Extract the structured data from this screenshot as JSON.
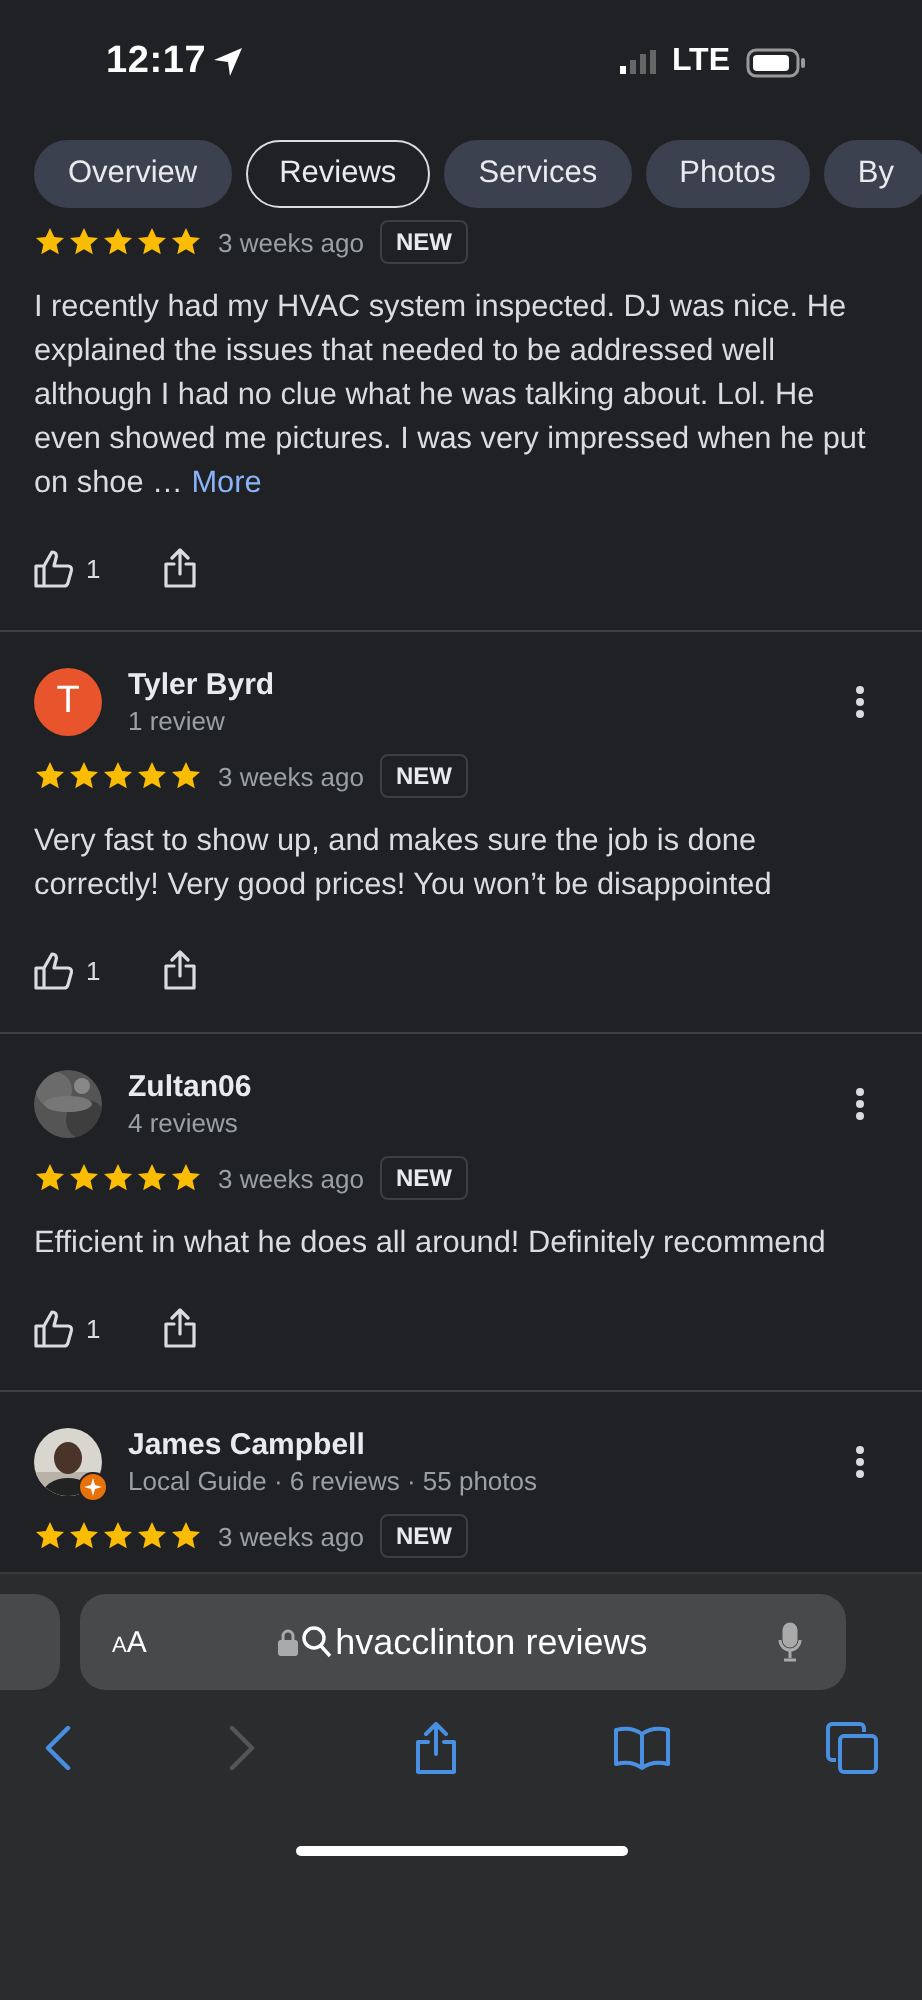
{
  "status_bar": {
    "time": "12:17",
    "network": "LTE"
  },
  "tabs": [
    {
      "label": "Overview",
      "selected": false
    },
    {
      "label": "Reviews",
      "selected": true
    },
    {
      "label": "Services",
      "selected": false
    },
    {
      "label": "Photos",
      "selected": false
    },
    {
      "label": "By",
      "selected": false
    }
  ],
  "reviews": [
    {
      "kind": "partial",
      "stars": 5,
      "time": "3 weeks ago",
      "badge": "NEW",
      "text": "I recently had my HVAC system inspected. DJ was nice. He explained the issues that needed to be addressed well although I had no clue what he was talking about. Lol. He even showed me pictures. I was very impressed when he put on shoe …",
      "more": "More",
      "likes": "1"
    },
    {
      "kind": "letter",
      "name": "Tyler Byrd",
      "initial": "T",
      "color": "#e8542c",
      "meta": "1 review",
      "stars": 5,
      "time": "3 weeks ago",
      "badge": "NEW",
      "text": "Very fast to show up, and makes sure the job is done correctly! Very good prices! You won’t be disappointed",
      "likes": "1"
    },
    {
      "name": "Zultan06",
      "meta": "4 reviews",
      "stars": 5,
      "time": "3 weeks ago",
      "badge": "NEW",
      "text": "Efficient in what he does all around! Definitely recommend",
      "likes": "1"
    },
    {
      "kind": "guide",
      "name": "James Campbell",
      "meta": "Local Guide · 6 reviews · 55 photos",
      "stars": 5,
      "time": "3 weeks ago",
      "badge": "NEW"
    }
  ],
  "browser": {
    "text_size": "AA",
    "address": "hvacclinton reviews",
    "forward_disabled": true
  }
}
